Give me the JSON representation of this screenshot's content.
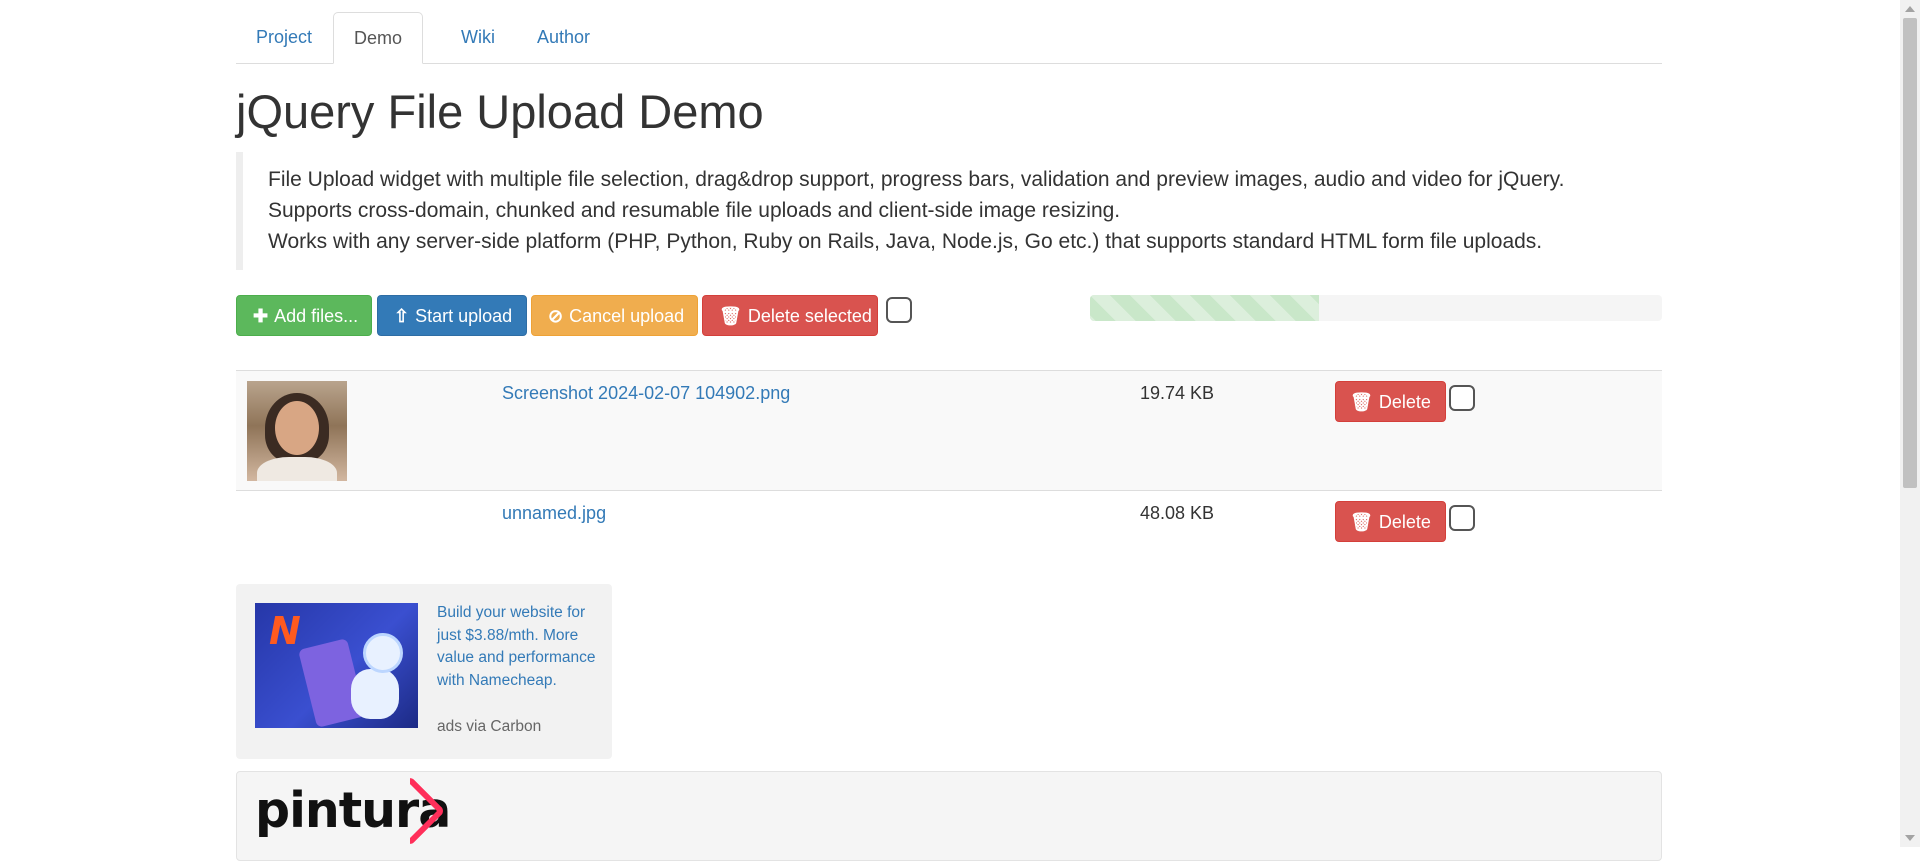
{
  "nav": {
    "tabs": [
      {
        "label": "Project",
        "active": false
      },
      {
        "label": "Demo",
        "active": true
      },
      {
        "label": "Wiki",
        "active": false
      },
      {
        "label": "Author",
        "active": false
      }
    ]
  },
  "page": {
    "title": "jQuery File Upload Demo",
    "description": [
      "File Upload widget with multiple file selection, drag&drop support, progress bars, validation and preview images, audio and video for jQuery.",
      "Supports cross-domain, chunked and resumable file uploads and client-side image resizing.",
      "Works with any server-side platform (PHP, Python, Ruby on Rails, Java, Node.js, Go etc.) that supports standard HTML form file uploads."
    ]
  },
  "toolbar": {
    "add_label": "Add files...",
    "start_label": "Start upload",
    "cancel_label": "Cancel upload",
    "delete_selected_label": "Delete selected",
    "select_all_checked": false,
    "progress_fraction": 0.4
  },
  "files": [
    {
      "name": "Screenshot 2024-02-07 104902.png",
      "size": "19.74 KB",
      "has_preview": true,
      "delete_label": "Delete",
      "checked": false
    },
    {
      "name": "unnamed.jpg",
      "size": "48.08 KB",
      "has_preview": false,
      "delete_label": "Delete",
      "checked": false
    }
  ],
  "ad": {
    "text": "Build your website for just $3.88/mth. More value and performance with Namecheap.",
    "via": "ads via Carbon"
  },
  "sponsor": {
    "logo_text": "pintura"
  },
  "colors": {
    "success": "#5cb85c",
    "primary": "#337ab7",
    "warning": "#f0ad4e",
    "danger": "#d9534f",
    "link": "#337ab7"
  }
}
